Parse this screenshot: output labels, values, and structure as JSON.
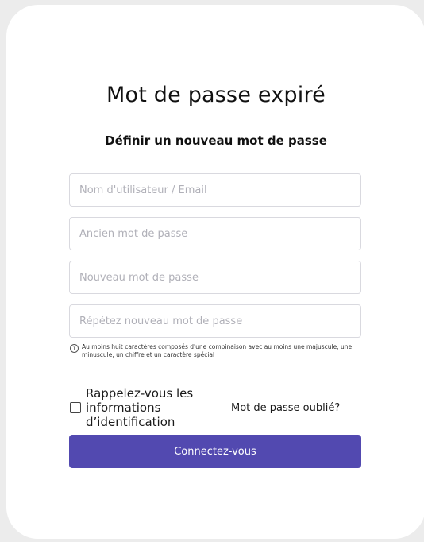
{
  "page": {
    "title": "Mot de passe expiré",
    "subtitle": "Définir un nouveau mot de passe"
  },
  "form": {
    "fields": [
      {
        "placeholder": "Nom d'utilisateur / Email",
        "value": ""
      },
      {
        "placeholder": "Ancien mot de passe",
        "value": ""
      },
      {
        "placeholder": "Nouveau mot de passe",
        "value": ""
      },
      {
        "placeholder": "Répétez nouveau mot de passe",
        "value": ""
      }
    ],
    "hint_icon": "info-icon",
    "hint": "Au moins huit caractères composés d'une combinaison avec au moins une majuscule, une minuscule, un chiffre et un caractère spécial",
    "remember_label": "Rappelez-vous les informations d’identification",
    "remember_checked": false,
    "forgot_link": "Mot de passe oublié?",
    "submit_label": "Connectez-vous"
  },
  "colors": {
    "primary": "#5249b0",
    "background": "#ececec",
    "card": "#ffffff"
  }
}
